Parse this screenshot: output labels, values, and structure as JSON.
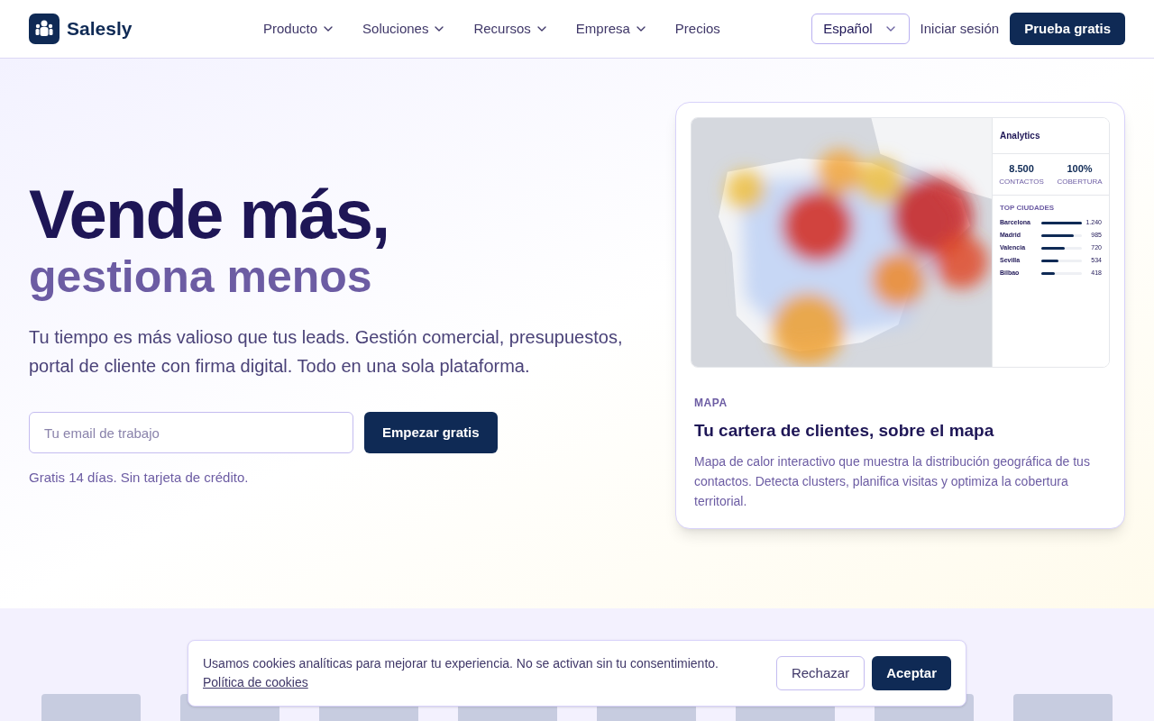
{
  "brand": {
    "name": "Salesly"
  },
  "nav": [
    {
      "label": "Producto",
      "has_menu": true
    },
    {
      "label": "Soluciones",
      "has_menu": true
    },
    {
      "label": "Recursos",
      "has_menu": true
    },
    {
      "label": "Empresa",
      "has_menu": true
    },
    {
      "label": "Precios",
      "has_menu": false
    }
  ],
  "language_select": {
    "value": "Español"
  },
  "login": "Iniciar sesión",
  "trial_button": "Prueba gratis",
  "hero": {
    "title": "Vende más,",
    "subtitle": "gestiona menos",
    "description": "Tu tiempo es más valioso que tus leads. Gestión comercial, presupuestos, portal de cliente con firma digital. Todo en una sola plataforma.",
    "email": {
      "placeholder": "Tu email de trabajo"
    },
    "cta": "Empezar gratis",
    "note": "Gratis 14 días. Sin tarjeta de crédito."
  },
  "feature_card": {
    "analytics": {
      "title": "Analytics",
      "stats": [
        {
          "value": "8.500",
          "label": "CONTACTOS"
        },
        {
          "value": "100%",
          "label": "COBERTURA"
        }
      ],
      "top_title": "TOP CIUDADES",
      "cities": [
        {
          "name": "Barcelona",
          "level": 1.0,
          "value": "1.240"
        },
        {
          "name": "Madrid",
          "level": 0.79,
          "value": "985"
        },
        {
          "name": "Valencia",
          "level": 0.58,
          "value": "720"
        },
        {
          "name": "Sevilla",
          "level": 0.43,
          "value": "534"
        },
        {
          "name": "Bilbao",
          "level": 0.34,
          "value": "418"
        }
      ]
    },
    "eyebrow": "MAPA",
    "title": "Tu cartera de clientes, sobre el mapa",
    "description": "Mapa de calor interactivo que muestra la distribución geográfica de tus contactos. Detecta clusters, planifica visitas y optimiza la cobertura territorial."
  },
  "cookie_banner": {
    "text": "Usamos cookies analíticas para mejorar tu experiencia. No se activan sin tu consentimiento.",
    "link": "Política de cookies",
    "reject": "Rechazar",
    "accept": "Aceptar"
  }
}
